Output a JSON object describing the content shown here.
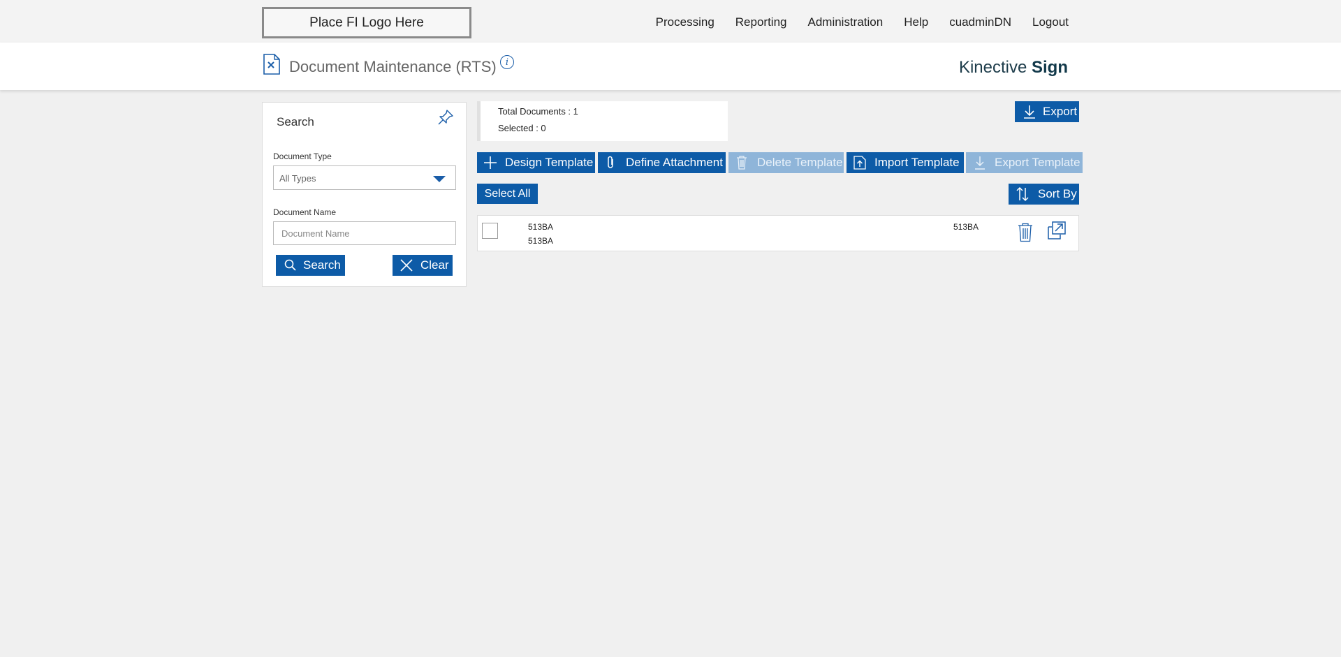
{
  "topbar": {
    "logo_text": "Place FI Logo Here",
    "nav": [
      "Processing",
      "Reporting",
      "Administration",
      "Help",
      "cuadminDN",
      "Logout"
    ]
  },
  "header": {
    "title": "Document Maintenance (RTS)",
    "info_glyph": "i",
    "brand_light": "Kinective ",
    "brand_bold": "Sign"
  },
  "search": {
    "title": "Search",
    "doc_type_label": "Document Type",
    "doc_type_value": "All Types",
    "doc_name_label": "Document Name",
    "doc_name_placeholder": "Document Name",
    "search_button": "Search",
    "clear_button": "Clear"
  },
  "summary": {
    "total": "Total Documents : 1",
    "selected": "Selected : 0"
  },
  "toolbar": {
    "export": "Export",
    "design_template": "Design Template",
    "define_attachment": "Define Attachment",
    "delete_template": "Delete Template",
    "import_template": "Import Template",
    "export_template": "Export Template",
    "select_all": "Select All",
    "sort_by": "Sort By"
  },
  "results": [
    {
      "name": "513BA",
      "description": "513BA",
      "code": "513BA"
    }
  ],
  "colors": {
    "accent": "#0d5ba7",
    "disabled": "#8fb5d9",
    "brand": "#12394a"
  },
  "icons": [
    "document-x-icon",
    "info-icon",
    "pin-icon",
    "chevron-down-icon",
    "search-icon",
    "close-icon",
    "download-icon",
    "plus-icon",
    "paperclip-icon",
    "trash-icon",
    "upload-icon",
    "sort-icon",
    "external-link-icon"
  ]
}
